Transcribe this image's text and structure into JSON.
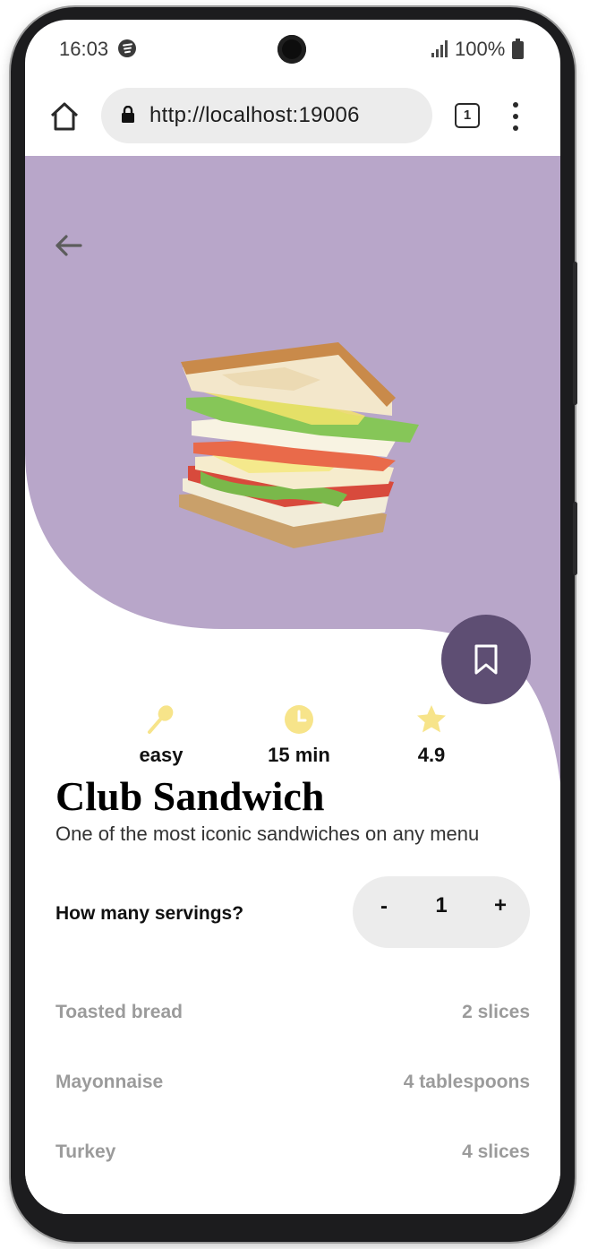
{
  "status_bar": {
    "time": "16:03",
    "battery": "100%",
    "icons": [
      "spotify-icon",
      "signal-icon",
      "battery-icon"
    ]
  },
  "browser": {
    "url": "http://localhost:19006",
    "tab_count": "1",
    "icons": [
      "home-icon",
      "lock-icon",
      "more-vert-icon"
    ]
  },
  "hero": {
    "background_color": "#b8a6c9",
    "image_alt": "club sandwich illustration"
  },
  "recipe": {
    "difficulty": "easy",
    "time": "15 min",
    "rating": "4.9",
    "title": "Club Sandwich",
    "description": "One of the most iconic sandwiches on any menu"
  },
  "servings": {
    "label": "How many servings?",
    "minus": "-",
    "count": "1",
    "plus": "+"
  },
  "ingredients": [
    {
      "name": "Toasted bread",
      "amount": "2 slices"
    },
    {
      "name": "Mayonnaise",
      "amount": "4 tablespoons"
    },
    {
      "name": "Turkey",
      "amount": "4 slices"
    }
  ],
  "colors": {
    "accent": "#5e4e73",
    "icon_yellow": "#f7e48a",
    "hero": "#b8a6c9",
    "muted_text": "#9b9b9b"
  }
}
